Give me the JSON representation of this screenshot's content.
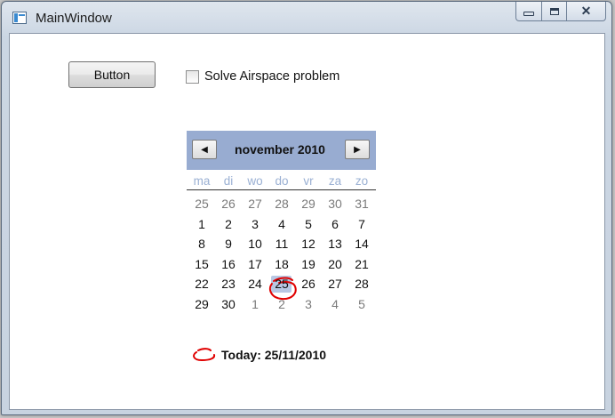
{
  "window": {
    "title": "MainWindow",
    "controls": [
      "minimize",
      "maximize",
      "close"
    ]
  },
  "content": {
    "button_label": "Button",
    "checkbox_label": "Solve Airspace problem",
    "checkbox_checked": false
  },
  "calendar": {
    "month_label": "november 2010",
    "prev_icon": "triangle-left-icon",
    "next_icon": "triangle-right-icon",
    "weekdays": [
      "ma",
      "di",
      "wo",
      "do",
      "vr",
      "za",
      "zo"
    ],
    "weeks": [
      [
        {
          "d": "25",
          "other": true
        },
        {
          "d": "26",
          "other": true
        },
        {
          "d": "27",
          "other": true
        },
        {
          "d": "28",
          "other": true
        },
        {
          "d": "29",
          "other": true
        },
        {
          "d": "30",
          "other": true
        },
        {
          "d": "31",
          "other": true
        }
      ],
      [
        {
          "d": "1"
        },
        {
          "d": "2"
        },
        {
          "d": "3"
        },
        {
          "d": "4"
        },
        {
          "d": "5"
        },
        {
          "d": "6"
        },
        {
          "d": "7"
        }
      ],
      [
        {
          "d": "8"
        },
        {
          "d": "9"
        },
        {
          "d": "10"
        },
        {
          "d": "11"
        },
        {
          "d": "12"
        },
        {
          "d": "13"
        },
        {
          "d": "14"
        }
      ],
      [
        {
          "d": "15"
        },
        {
          "d": "16"
        },
        {
          "d": "17"
        },
        {
          "d": "18"
        },
        {
          "d": "19"
        },
        {
          "d": "20"
        },
        {
          "d": "21"
        }
      ],
      [
        {
          "d": "22"
        },
        {
          "d": "23"
        },
        {
          "d": "24"
        },
        {
          "d": "25",
          "today": true
        },
        {
          "d": "26"
        },
        {
          "d": "27"
        },
        {
          "d": "28"
        }
      ],
      [
        {
          "d": "29"
        },
        {
          "d": "30"
        },
        {
          "d": "1",
          "other": true
        },
        {
          "d": "2",
          "other": true
        },
        {
          "d": "3",
          "other": true
        },
        {
          "d": "4",
          "other": true
        },
        {
          "d": "5",
          "other": true
        }
      ]
    ],
    "today_label": "Today: 25/11/2010",
    "header_color": "#98acd1",
    "today_highlight_color": "#b8c7e3",
    "annotation_color": "#e00000"
  }
}
